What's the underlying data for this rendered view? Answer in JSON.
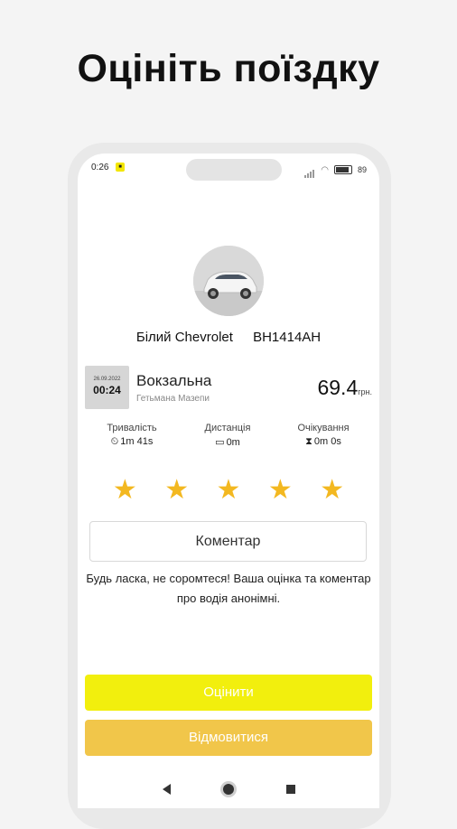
{
  "headline": "Оцініть поїздку",
  "status": {
    "time": "0:26",
    "battery": "89"
  },
  "car": {
    "name": "Білий Chevrolet",
    "plate": "BH1414AH"
  },
  "trip": {
    "date": "26.09.2022",
    "time": "00:24",
    "address_main": "Вокзальна",
    "address_sub": "Гетьмана Мазепи",
    "price": "69.4",
    "currency": "грн."
  },
  "metrics": {
    "duration": {
      "label": "Тривалість",
      "value": "1m 41s"
    },
    "distance": {
      "label": "Дистанція",
      "value": "0m"
    },
    "waiting": {
      "label": "Очікування",
      "value": "0m 0s"
    }
  },
  "rating": {
    "stars": 5,
    "max": 5
  },
  "comment_placeholder": "Коментар",
  "note": "Будь ласка, не соромтеся! Ваша оцінка та коментар про водія анонімні.",
  "buttons": {
    "rate": "Оцінити",
    "decline": "Відмовитися"
  },
  "colors": {
    "accent_yellow": "#f2ef0d",
    "decline_yellow": "#f1c64a",
    "star": "#f3b820"
  }
}
